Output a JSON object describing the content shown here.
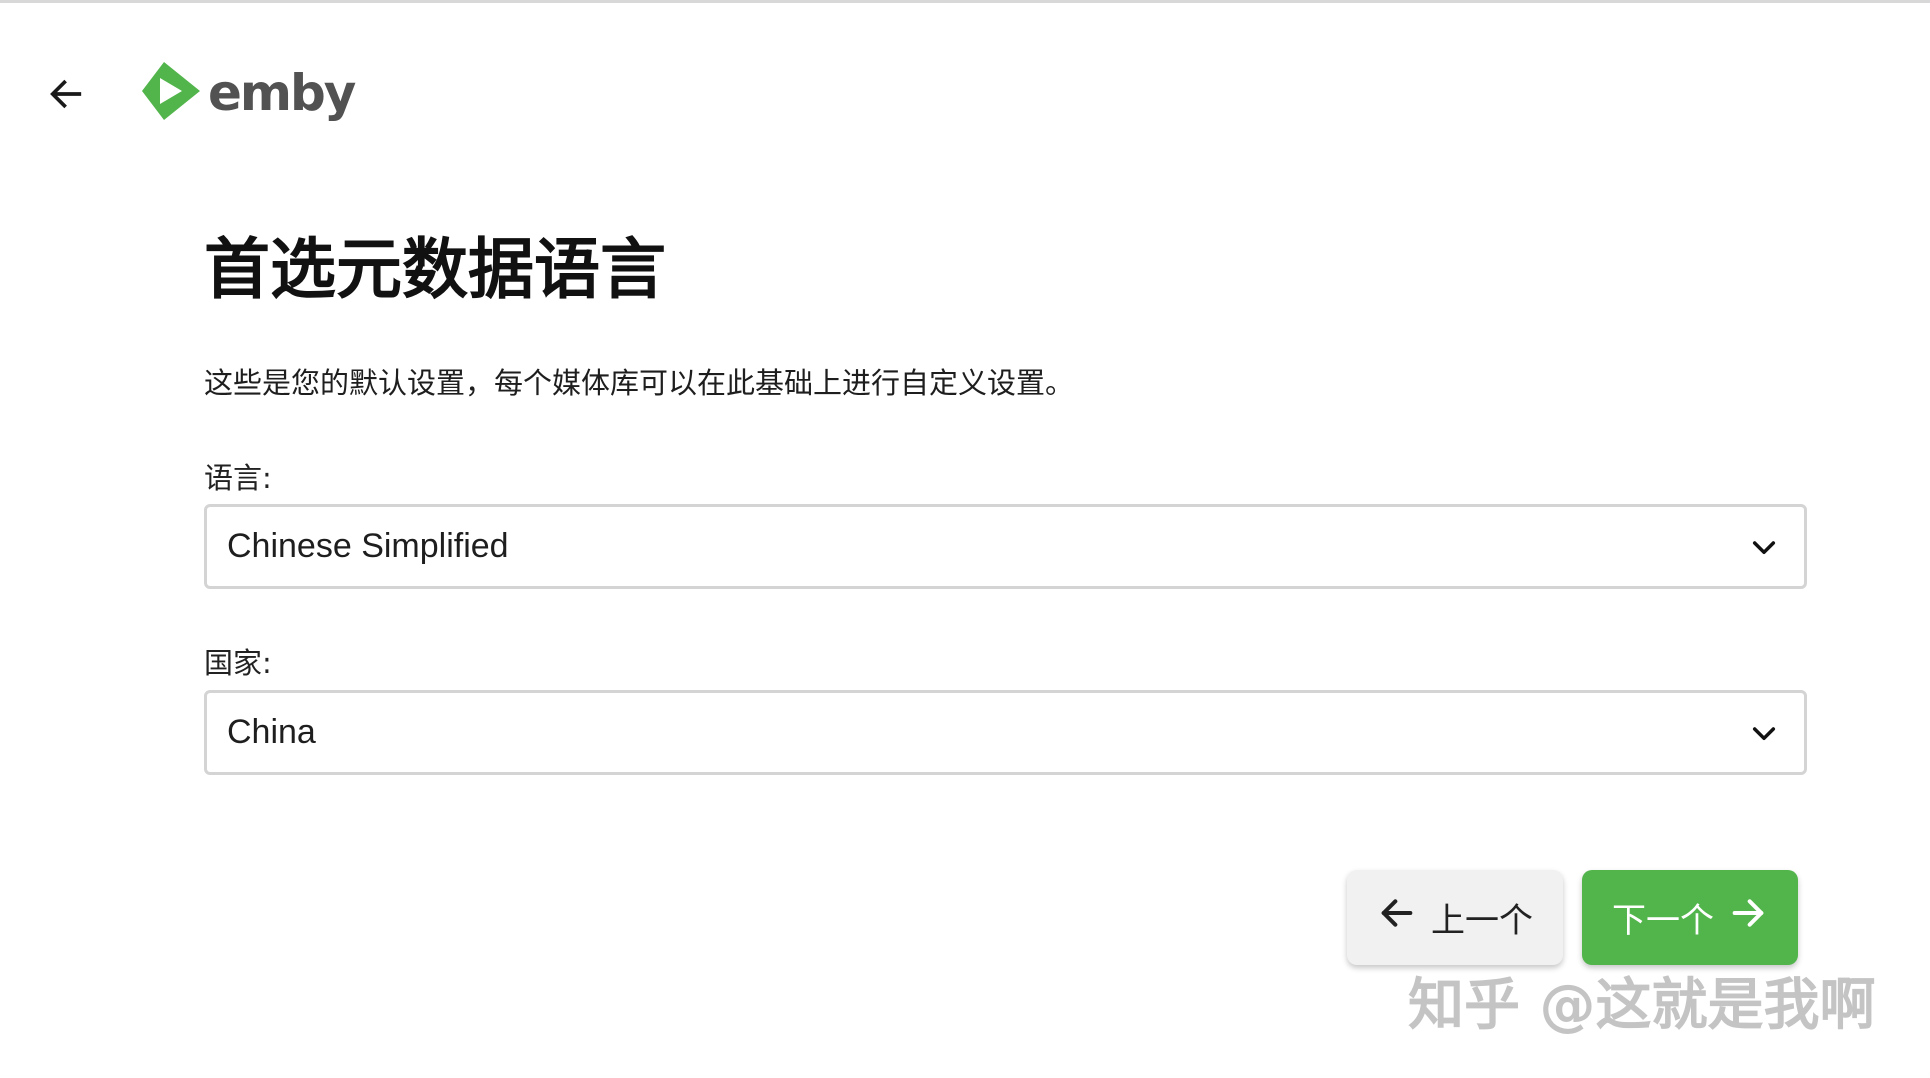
{
  "header": {
    "back_icon": "arrow-left-icon",
    "logo_text": "emby",
    "logo_color": "#52b54b"
  },
  "main": {
    "title": "首选元数据语言",
    "description": "这些是您的默认设置，每个媒体库可以在此基础上进行自定义设置。",
    "language": {
      "label": "语言:",
      "value": "Chinese Simplified"
    },
    "country": {
      "label": "国家:",
      "value": "China"
    }
  },
  "footer": {
    "prev_label": "上一个",
    "next_label": "下一个",
    "accent_color": "#52b54b"
  },
  "watermark": "知乎 @这就是我啊"
}
